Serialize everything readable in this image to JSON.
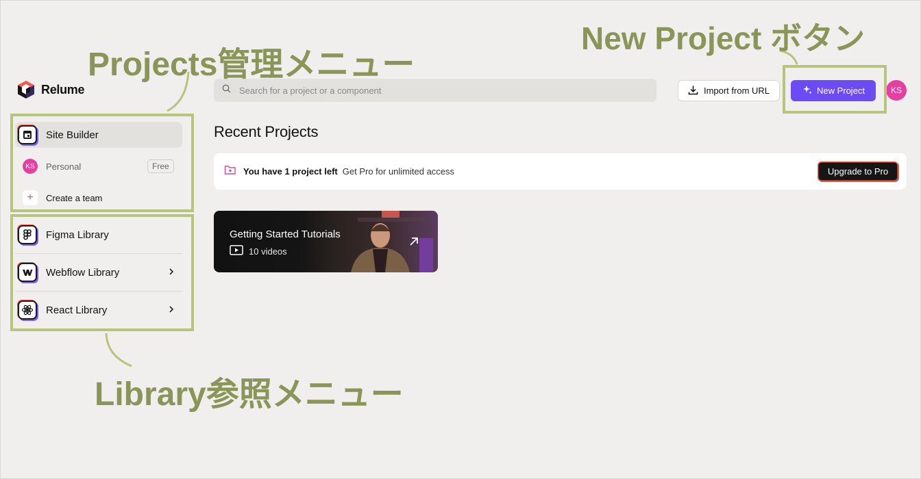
{
  "app": {
    "name": "Relume"
  },
  "sidebar": {
    "items": [
      {
        "label": "Site Builder"
      },
      {
        "label": "Figma Library"
      },
      {
        "label": "Webflow Library"
      },
      {
        "label": "React Library"
      }
    ],
    "workspace": {
      "avatar": "KS",
      "label": "Personal",
      "badge": "Free"
    },
    "create_team": {
      "label": "Create a team"
    }
  },
  "topbar": {
    "search_placeholder": "Search for a project or a component",
    "import_label": "Import from URL",
    "new_project_label": "New Project",
    "user_avatar": "KS"
  },
  "main": {
    "section_title": "Recent Projects",
    "banner": {
      "strong": "You have 1 project left",
      "text": "Get Pro for unlimited access",
      "button": "Upgrade to Pro"
    },
    "tutorial_card": {
      "title": "Getting Started Tutorials",
      "subtitle": "10 videos"
    }
  },
  "annotations": {
    "projects_menu": "Projects管理メニュー",
    "new_project_button": "New Project ボタン",
    "library_menu": "Library参照メニュー"
  },
  "colors": {
    "accent": "#6c4bf5",
    "avatar": "#e53fa1",
    "annotation": "#b7c47b",
    "annotation_text": "#8a9558"
  },
  "icons": [
    "relume-logo-icon",
    "site-builder-icon",
    "plus-icon",
    "figma-icon",
    "webflow-icon",
    "react-icon",
    "chevron-right-icon",
    "search-icon",
    "download-icon",
    "sparkle-icon",
    "folder-plus-icon",
    "play-icon",
    "arrow-up-right-icon"
  ]
}
